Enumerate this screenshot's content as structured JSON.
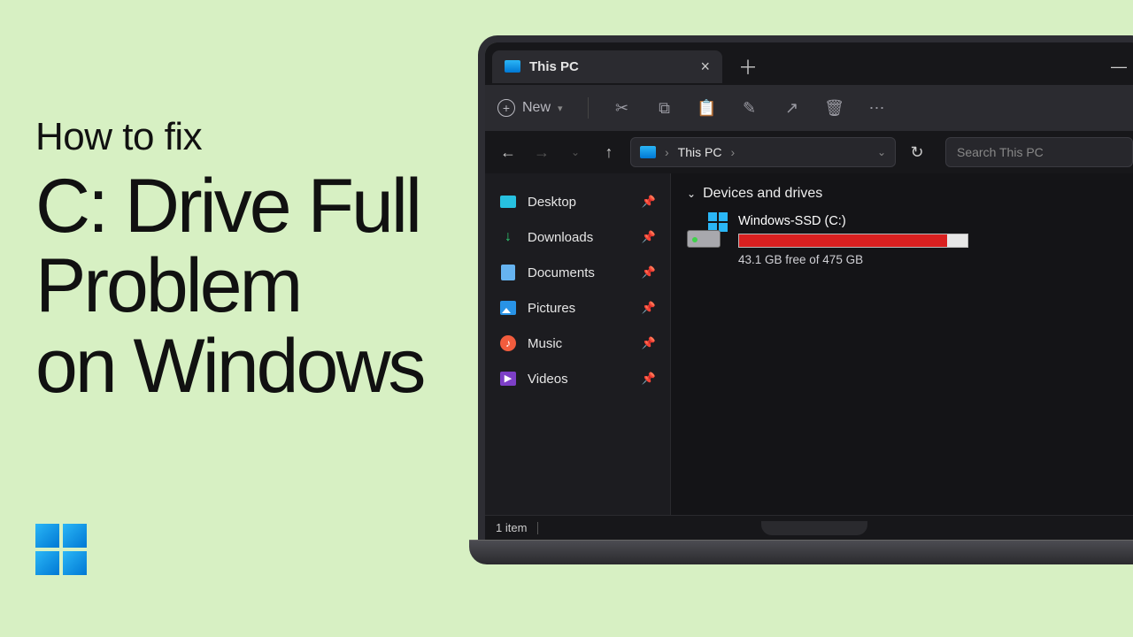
{
  "headline": {
    "small": "How to fix",
    "line1": "C: Drive Full",
    "line2": "Problem",
    "line3": "on Windows"
  },
  "tab": {
    "title": "This PC"
  },
  "toolbar": {
    "new_label": "New"
  },
  "breadcrumb": {
    "root": "This PC"
  },
  "search": {
    "placeholder": "Search This PC"
  },
  "sidebar": {
    "items": [
      {
        "label": "Desktop"
      },
      {
        "label": "Downloads"
      },
      {
        "label": "Documents"
      },
      {
        "label": "Pictures"
      },
      {
        "label": "Music"
      },
      {
        "label": "Videos"
      }
    ]
  },
  "section_title": "Devices and drives",
  "drive": {
    "name": "Windows-SSD (C:)",
    "free_text": "43.1 GB free of 475 GB",
    "fill_percent": 91
  },
  "status": {
    "count_text": "1 item"
  }
}
